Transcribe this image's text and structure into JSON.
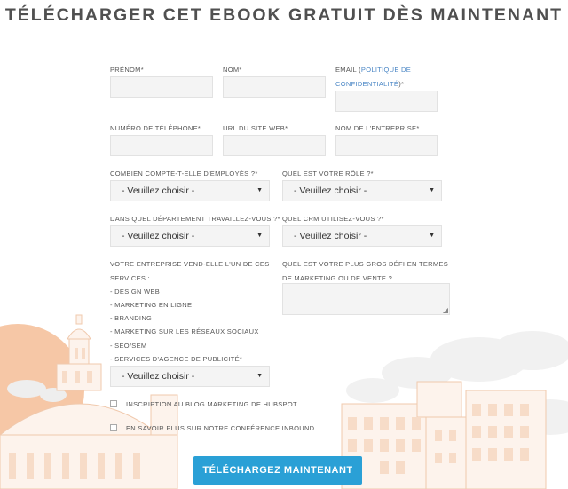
{
  "title": "TÉLÉCHARGER CET EBOOK GRATUIT DÈS MAINTENANT",
  "fields": {
    "prenom": "PRÉNOM*",
    "nom": "NOM*",
    "email_prefix": "EMAIL (",
    "email_link": "POLITIQUE DE CONFIDENTIALITÉ",
    "email_suffix": ")*",
    "phone": "NUMÉRO DE TÉLÉPHONE*",
    "url": "URL DU SITE WEB*",
    "company": "NOM DE L'ENTREPRISE*",
    "employees": "COMBIEN COMPTE-T-ELLE D'EMPLOYÉS ?*",
    "role": "QUEL EST VOTRE RÔLE ?*",
    "department": "DANS QUEL DÉPARTEMENT TRAVAILLEZ-VOUS ?*",
    "crm": "QUEL CRM UTILISEZ-VOUS ?*",
    "services_q": "VOTRE ENTREPRISE VEND-ELLE L'UN DE CES SERVICES :",
    "challenge_q": "QUEL EST VOTRE PLUS GROS DÉFI EN TERMES DE MARKETING OU DE VENTE ?"
  },
  "select_placeholder": "- Veuillez choisir -",
  "services": [
    "- DESIGN WEB",
    "- MARKETING EN LIGNE",
    "- BRANDING",
    "- MARKETING SUR LES RÉSEAUX SOCIAUX",
    "- SEO/SEM",
    "- SERVICES D'AGENCE DE PUBLICITÉ*"
  ],
  "checkboxes": {
    "blog": "INSCRIPTION AU BLOG MARKETING DE HUBSPOT",
    "inbound": "EN SAVOIR PLUS SUR NOTRE CONFÉRENCE INBOUND"
  },
  "submit": "TÉLÉCHARGEZ MAINTENANT",
  "colors": {
    "accent": "#2aa0d6",
    "link": "#4a86c5",
    "sun": "#f6c7a6"
  }
}
